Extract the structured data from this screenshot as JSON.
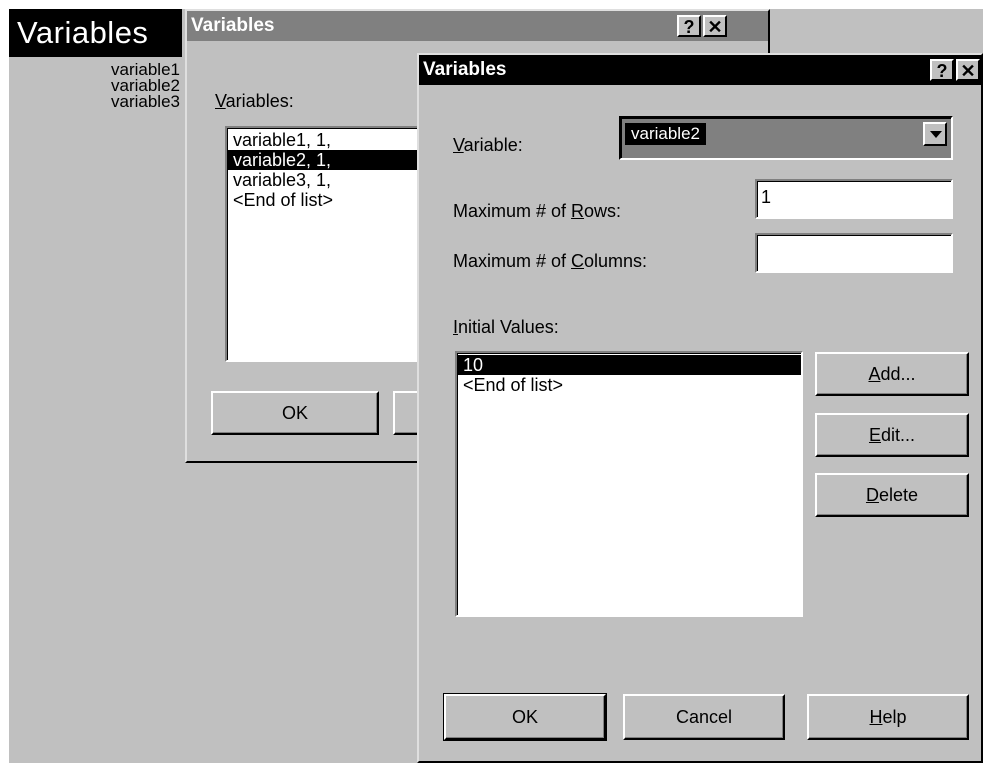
{
  "background": {
    "header_label": "Variables",
    "variables": [
      "variable1",
      "variable2",
      "variable3"
    ]
  },
  "dialog_back": {
    "title": "Variables",
    "help_glyph": "?",
    "close_glyph": "✕",
    "list_label_underline": "V",
    "list_label_rest": "ariables:",
    "list_items": [
      "variable1, 1,",
      "variable2, 1,",
      "variable3, 1,",
      "<End of list>"
    ],
    "selected_index": 1,
    "ok_label": "OK"
  },
  "dialog_front": {
    "title": "Variables",
    "help_glyph": "?",
    "close_glyph": "✕",
    "variable_label_underline": "V",
    "variable_label_rest": "ariable:",
    "variable_value": "variable2",
    "max_rows_label_pre": "Maximum # of ",
    "max_rows_label_underline": "R",
    "max_rows_label_post": "ows:",
    "max_rows_value": "1",
    "max_cols_label_pre": "Maximum # of ",
    "max_cols_label_underline": "C",
    "max_cols_label_post": "olumns:",
    "max_cols_value": "",
    "initial_values_label_underline": "I",
    "initial_values_label_rest": "nitial Values:",
    "initial_values": [
      "10",
      "<End of list>"
    ],
    "selected_index": 0,
    "add_underline": "A",
    "add_rest": "dd...",
    "edit_underline": "E",
    "edit_rest": "dit...",
    "delete_underline": "D",
    "delete_rest": "elete",
    "ok_label": "OK",
    "cancel_label": "Cancel",
    "help_underline": "H",
    "help_rest": "elp"
  },
  "colors": {
    "face": "#c0c0c0",
    "back_title_bar": "#808080",
    "front_title_bar": "#000000",
    "selection": "#000000"
  }
}
